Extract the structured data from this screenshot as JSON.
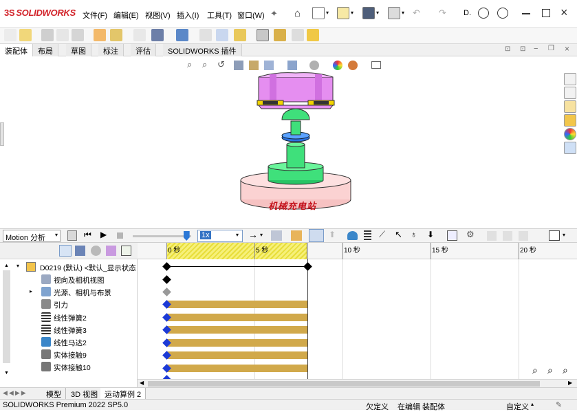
{
  "app": {
    "logo_prefix": "3S",
    "logo_text": "SOLIDWORKS"
  },
  "menu": {
    "items": [
      "文件(F)",
      "编辑(E)",
      "视图(V)",
      "插入(I)",
      "工具(T)",
      "窗口(W)"
    ],
    "more": "D."
  },
  "tabs": {
    "items": [
      "装配体",
      "布局",
      "草图",
      "标注",
      "评估",
      "SOLIDWORKS 插件"
    ],
    "active_index": 0
  },
  "model": {
    "base_label": "机械充电站"
  },
  "motion": {
    "study_type": "Motion 分析",
    "speed": "1x",
    "playback_slider_fraction": 0.92
  },
  "timeline": {
    "ticks": [
      "0 秒",
      "5 秒",
      "10 秒",
      "15 秒",
      "20 秒"
    ]
  },
  "tree": {
    "root": "D0219 (默认) <默认_显示状态",
    "items": [
      {
        "label": "视向及相机视图",
        "icon": "camera-view-icon",
        "expander": false
      },
      {
        "label": "光源、相机与布景",
        "icon": "lights-cameras-scene-icon",
        "expander": true
      },
      {
        "label": "引力",
        "icon": "gravity-icon",
        "expander": false
      },
      {
        "label": "线性弹簧2",
        "icon": "spring-icon",
        "expander": false
      },
      {
        "label": "线性弹簧3",
        "icon": "spring-icon",
        "expander": false
      },
      {
        "label": "线性马达2",
        "icon": "linear-motor-icon",
        "expander": false
      },
      {
        "label": "实体接触9",
        "icon": "contact-icon",
        "expander": false
      },
      {
        "label": "实体接触10",
        "icon": "contact-icon",
        "expander": false
      }
    ]
  },
  "bottom_tabs": {
    "items": [
      "模型",
      "3D 视图",
      "运动算例 2"
    ],
    "active_index": 2
  },
  "status": {
    "product": "SOLIDWORKS Premium 2022 SP5.0",
    "under_defined": "欠定义",
    "editing": "在编辑 装配体",
    "custom": "自定义"
  },
  "colors": {
    "accent": "#2b78d6",
    "bar": "#d1a94b",
    "key_blue": "#1c3ad6",
    "timeline_hatch": "#f0e84a",
    "part_pink": "#e58ef0",
    "part_green": "#3fe07b",
    "base_pink": "#fbd2d2"
  }
}
